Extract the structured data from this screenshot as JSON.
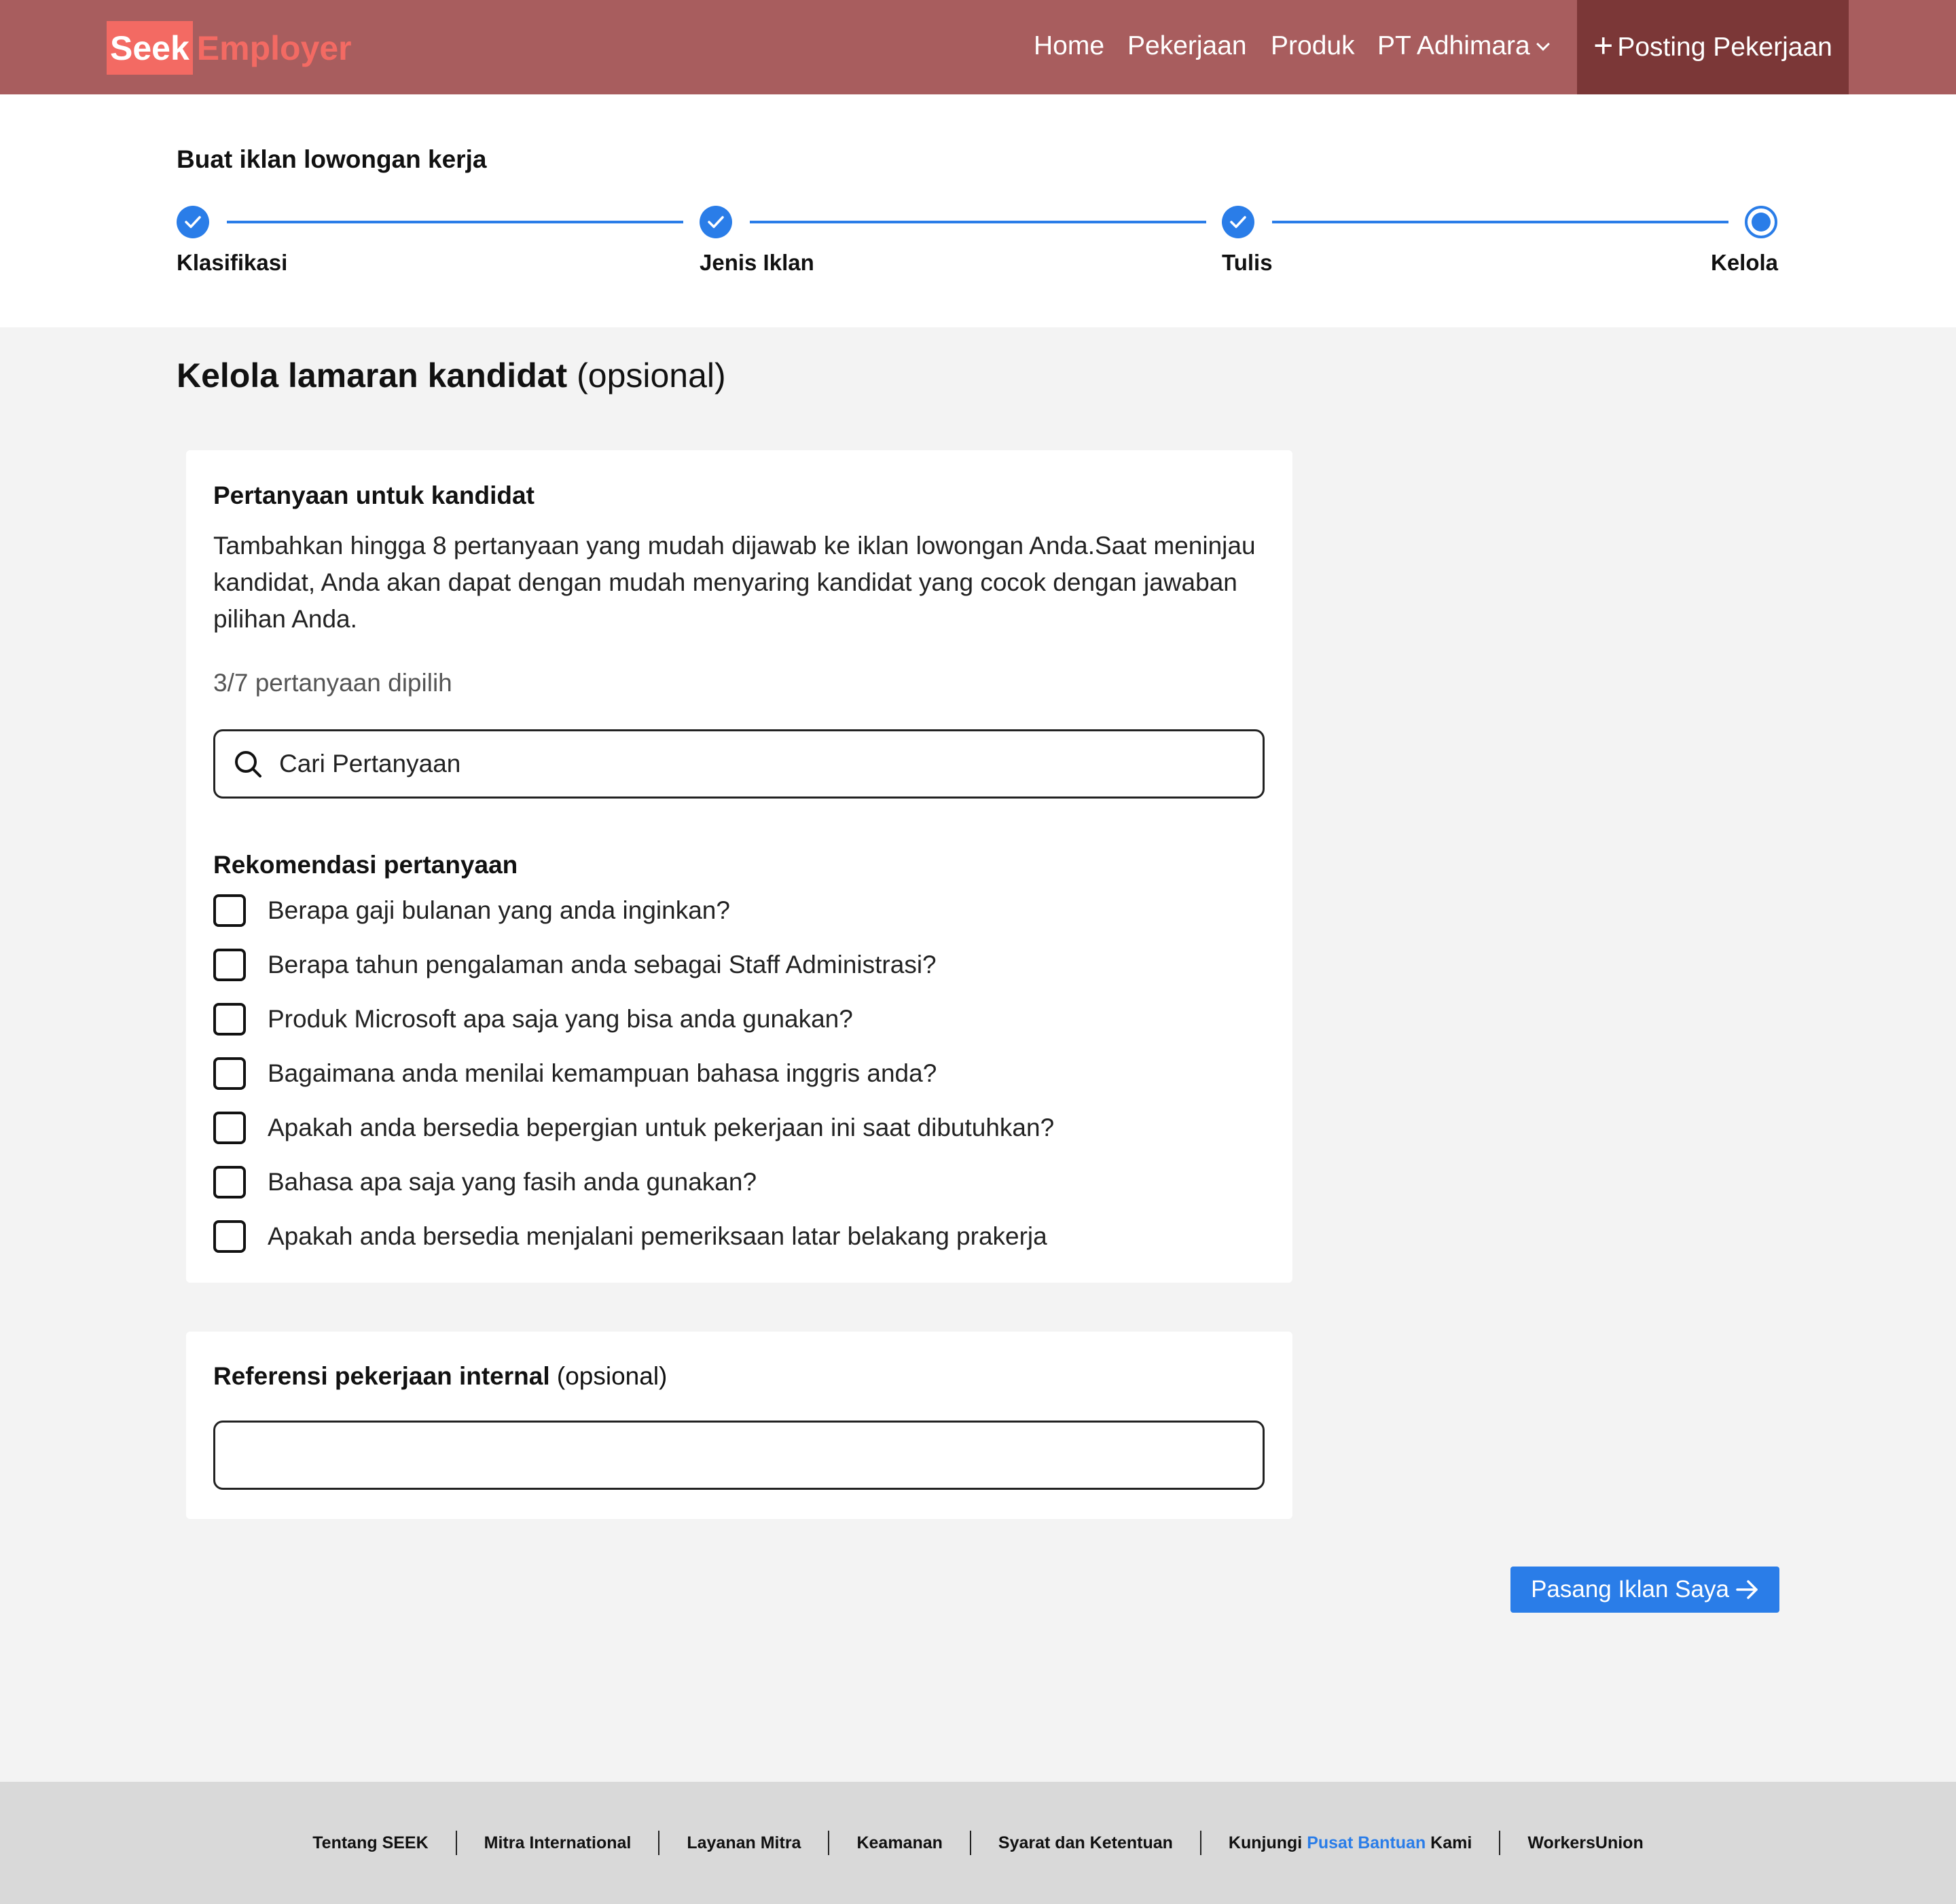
{
  "header": {
    "logo_seek": "Seek",
    "logo_employer": "Employer",
    "nav": {
      "home": "Home",
      "jobs": "Pekerjaan",
      "products": "Produk",
      "company": "PT Adhimara"
    },
    "post_button": "Posting Pekerjaan"
  },
  "stepper": {
    "title": "Buat iklan lowongan kerja",
    "steps": [
      {
        "label": "Klasifikasi",
        "state": "done"
      },
      {
        "label": "Jenis Iklan",
        "state": "done"
      },
      {
        "label": "Tulis",
        "state": "done"
      },
      {
        "label": "Kelola",
        "state": "current"
      }
    ]
  },
  "main": {
    "title_bold": "Kelola lamaran kandidat",
    "title_optional": "(opsional)",
    "questions_card": {
      "title": "Pertanyaan untuk kandidat",
      "description": "Tambahkan hingga 8 pertanyaan yang mudah dijawab ke iklan lowongan Anda.Saat meninjau kandidat, Anda akan dapat dengan mudah menyaring kandidat yang cocok dengan jawaban pilihan Anda.",
      "counter": "3/7 pertanyaan dipilih",
      "search_placeholder": "Cari Pertanyaan",
      "recommendation_title": "Rekomendasi pertanyaan",
      "questions": [
        "Berapa gaji bulanan yang anda inginkan?",
        "Berapa tahun pengalaman anda sebagai Staff Administrasi?",
        "Produk Microsoft apa saja yang bisa anda gunakan?",
        "Bagaimana anda menilai kemampuan bahasa inggris anda?",
        "Apakah anda bersedia bepergian untuk pekerjaan ini saat dibutuhkan?",
        "Bahasa apa saja yang fasih anda gunakan?",
        "Apakah anda bersedia menjalani pemeriksaan latar belakang prakerja"
      ]
    },
    "reference_card": {
      "title_bold": "Referensi pekerjaan internal",
      "title_optional": "(opsional)",
      "input_value": ""
    },
    "submit_button": "Pasang Iklan Saya"
  },
  "footer": {
    "links": [
      "Tentang SEEK",
      "Mitra International",
      "Layanan Mitra",
      "Keamanan",
      "Syarat dan Ketentuan"
    ],
    "help_prefix": "Kunjungi",
    "help_link": "Pusat Bantuan",
    "help_suffix": "Kami",
    "last_link": "WorkersUnion"
  },
  "colors": {
    "header_bg": "#a85d5e",
    "post_button_bg": "#7b3737",
    "logo": "#f36a63",
    "accent": "#2a7de8"
  },
  "icons": {
    "search": "search-icon",
    "check": "check-icon",
    "plus": "plus-icon",
    "chevron": "chevron-down-icon",
    "arrow": "arrow-right-icon"
  }
}
